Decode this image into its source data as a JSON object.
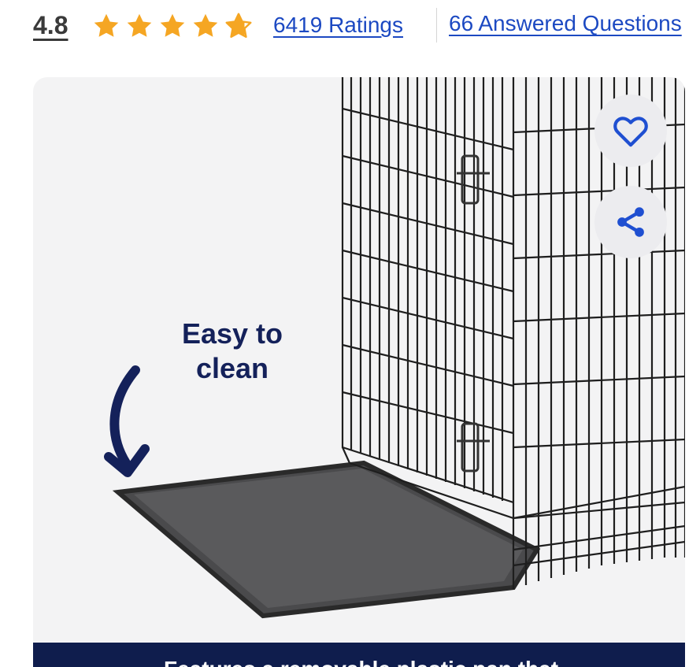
{
  "rating": {
    "score": "4.8",
    "stars_value": 4.8,
    "stars_max": 5,
    "ratings_link": "6419 Ratings",
    "questions_link": "66 Answered Questions"
  },
  "product_image": {
    "caption_line1": "Easy to",
    "caption_line2": "clean",
    "banner_text": "Features a removable plastic pan that"
  },
  "actions": {
    "favorite_icon": "heart-icon",
    "share_icon": "share-icon"
  },
  "colors": {
    "star": "#f5a623",
    "link": "#1c49c2",
    "navy": "#14215a",
    "icon_blue": "#1f4fd1"
  }
}
